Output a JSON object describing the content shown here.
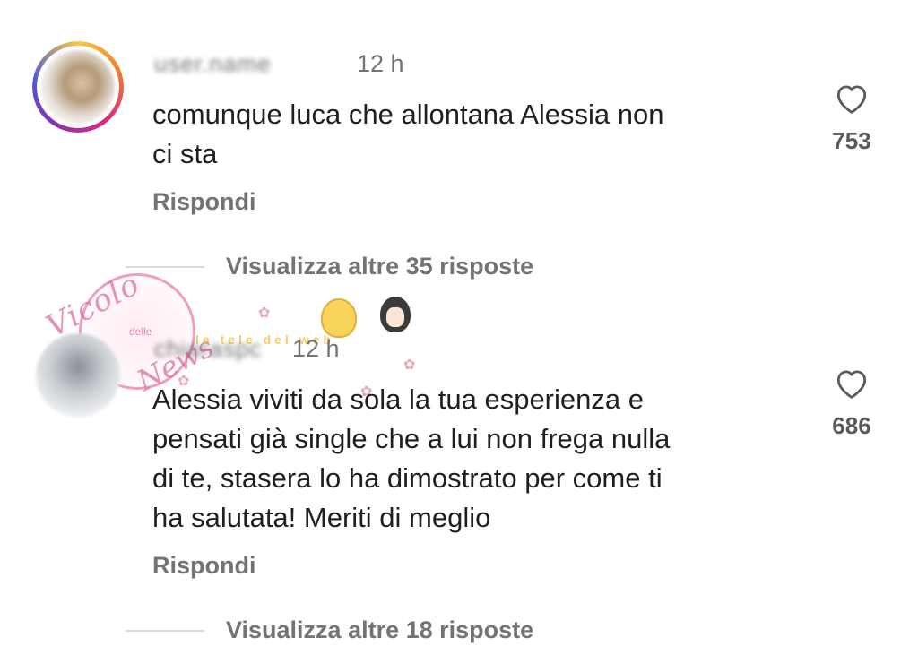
{
  "comments": [
    {
      "username": "user.name",
      "time": "12 h",
      "text_line1": "comunque luca che allontana Alessia non",
      "text_line2": "ci sta",
      "reply_label": "Rispondi",
      "like_count": "753",
      "view_more": "Visualizza altre 35 risposte"
    },
    {
      "username": "chiaraspc",
      "time": "12 h",
      "text_line1": "Alessia viviti da sola la tua esperienza e",
      "text_line2": "pensati già single che a lui non frega nulla",
      "text_line3": "di te, stasera lo ha dimostrato per come ti",
      "text_line4": "ha salutata! Meriti di meglio",
      "reply_label": "Rispondi",
      "like_count": "686",
      "view_more": "Visualizza altre 18 risposte"
    }
  ],
  "watermark": {
    "line1": "Vicolo",
    "small": "delle",
    "line2": "News",
    "banner": "le tele del web"
  },
  "icons": {
    "like": "heart-outline-icon"
  },
  "colors": {
    "text": "#1f1f1f",
    "muted": "#737373",
    "divider": "#dbdbdb"
  }
}
